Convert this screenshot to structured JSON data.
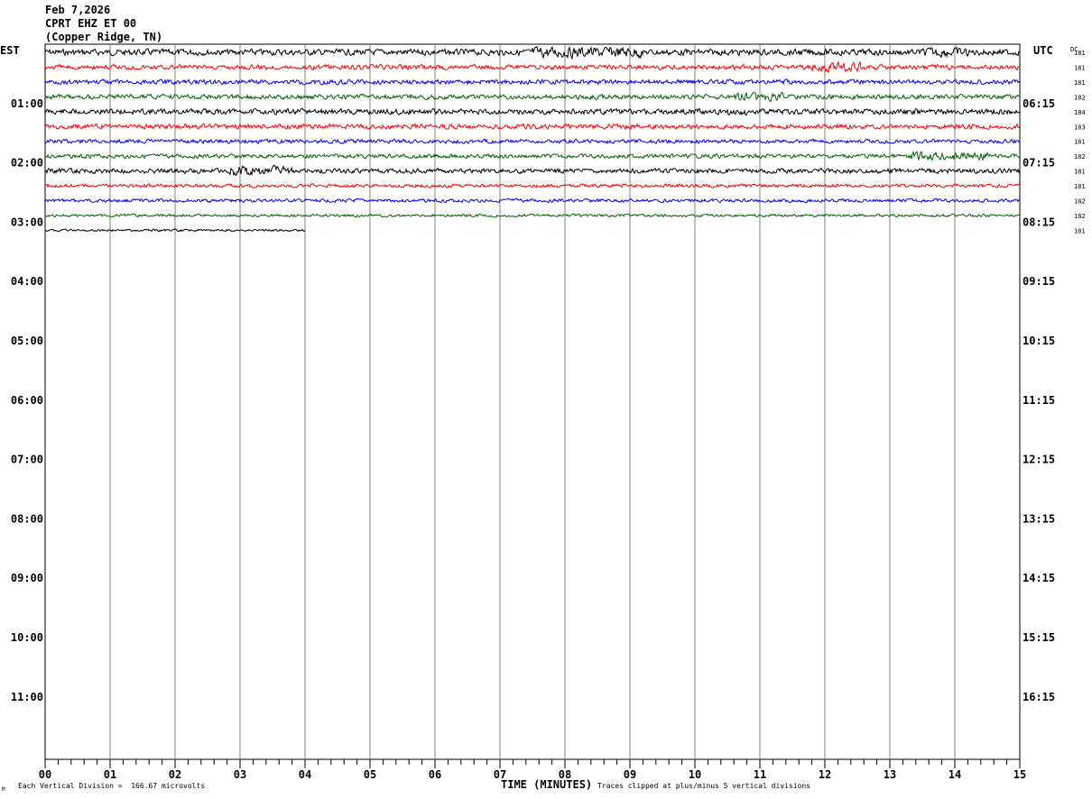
{
  "header": {
    "date": "Feb 7,2026",
    "station": "CPRT EHZ ET 00",
    "location": "(Copper Ridge, TN)"
  },
  "left_axis_title": "EST",
  "right_axis_title": "UTC",
  "dc_label": "DC",
  "footer": {
    "scale_note": "Each Vertical Division =  166.67 microvolts",
    "clip_note": "Traces clipped at plus/minus 5 vertical divisions",
    "corner_mark": "M"
  },
  "colors": {
    "trace_cycle": [
      "#000000",
      "#ff0000",
      "#0000ff",
      "#006400"
    ],
    "grid": "#808080"
  },
  "chart_data": {
    "type": "line",
    "title": "CPRT EHZ ET 00",
    "xlabel": "TIME (MINUTES)",
    "xlim": [
      0,
      15
    ],
    "x_ticks": [
      "00",
      "01",
      "02",
      "03",
      "04",
      "05",
      "06",
      "07",
      "08",
      "09",
      "10",
      "11",
      "12",
      "13",
      "14",
      "15"
    ],
    "rows_per_hour": 4,
    "row_minutes": 15,
    "left_time_labels": [
      "01:00",
      "02:00",
      "03:00",
      "04:00",
      "05:00",
      "06:00",
      "07:00",
      "08:00",
      "09:00",
      "10:00",
      "11:00"
    ],
    "right_time_labels": [
      "06:15",
      "07:15",
      "08:15",
      "09:15",
      "10:15",
      "11:15",
      "12:15",
      "13:15",
      "14:15",
      "15:15",
      "16:15"
    ],
    "traces": [
      {
        "row": 0,
        "dc": "181",
        "amplitude": 4.5,
        "bursts": [
          {
            "from": 7.5,
            "to": 9.2,
            "gain": 1.8
          },
          {
            "from": 13.5,
            "to": 14.2,
            "gain": 1.5
          }
        ]
      },
      {
        "row": 1,
        "dc": "181",
        "amplitude": 3.5,
        "bursts": [
          {
            "from": 11.8,
            "to": 12.6,
            "gain": 2.0
          }
        ]
      },
      {
        "row": 2,
        "dc": "181",
        "amplitude": 3.5,
        "bursts": []
      },
      {
        "row": 3,
        "dc": "182",
        "amplitude": 3.5,
        "bursts": [
          {
            "from": 10.6,
            "to": 11.4,
            "gain": 1.8
          }
        ]
      },
      {
        "row": 4,
        "dc": "184",
        "amplitude": 4.0,
        "bursts": [
          {
            "from": 10.5,
            "to": 10.8,
            "gain": 1.6
          }
        ]
      },
      {
        "row": 5,
        "dc": "183",
        "amplitude": 3.5,
        "bursts": []
      },
      {
        "row": 6,
        "dc": "181",
        "amplitude": 3.0,
        "bursts": []
      },
      {
        "row": 7,
        "dc": "182",
        "amplitude": 3.0,
        "bursts": [
          {
            "from": 13.3,
            "to": 14.5,
            "gain": 2.0
          }
        ]
      },
      {
        "row": 8,
        "dc": "181",
        "amplitude": 3.5,
        "bursts": [
          {
            "from": 2.8,
            "to": 3.8,
            "gain": 2.0
          }
        ]
      },
      {
        "row": 9,
        "dc": "181",
        "amplitude": 2.5,
        "bursts": []
      },
      {
        "row": 10,
        "dc": "182",
        "amplitude": 2.5,
        "bursts": []
      },
      {
        "row": 11,
        "dc": "182",
        "amplitude": 2.0,
        "bursts": []
      },
      {
        "row": 12,
        "dc": "181",
        "amplitude": 1.6,
        "bursts": [],
        "end_minute": 4.0
      }
    ]
  }
}
